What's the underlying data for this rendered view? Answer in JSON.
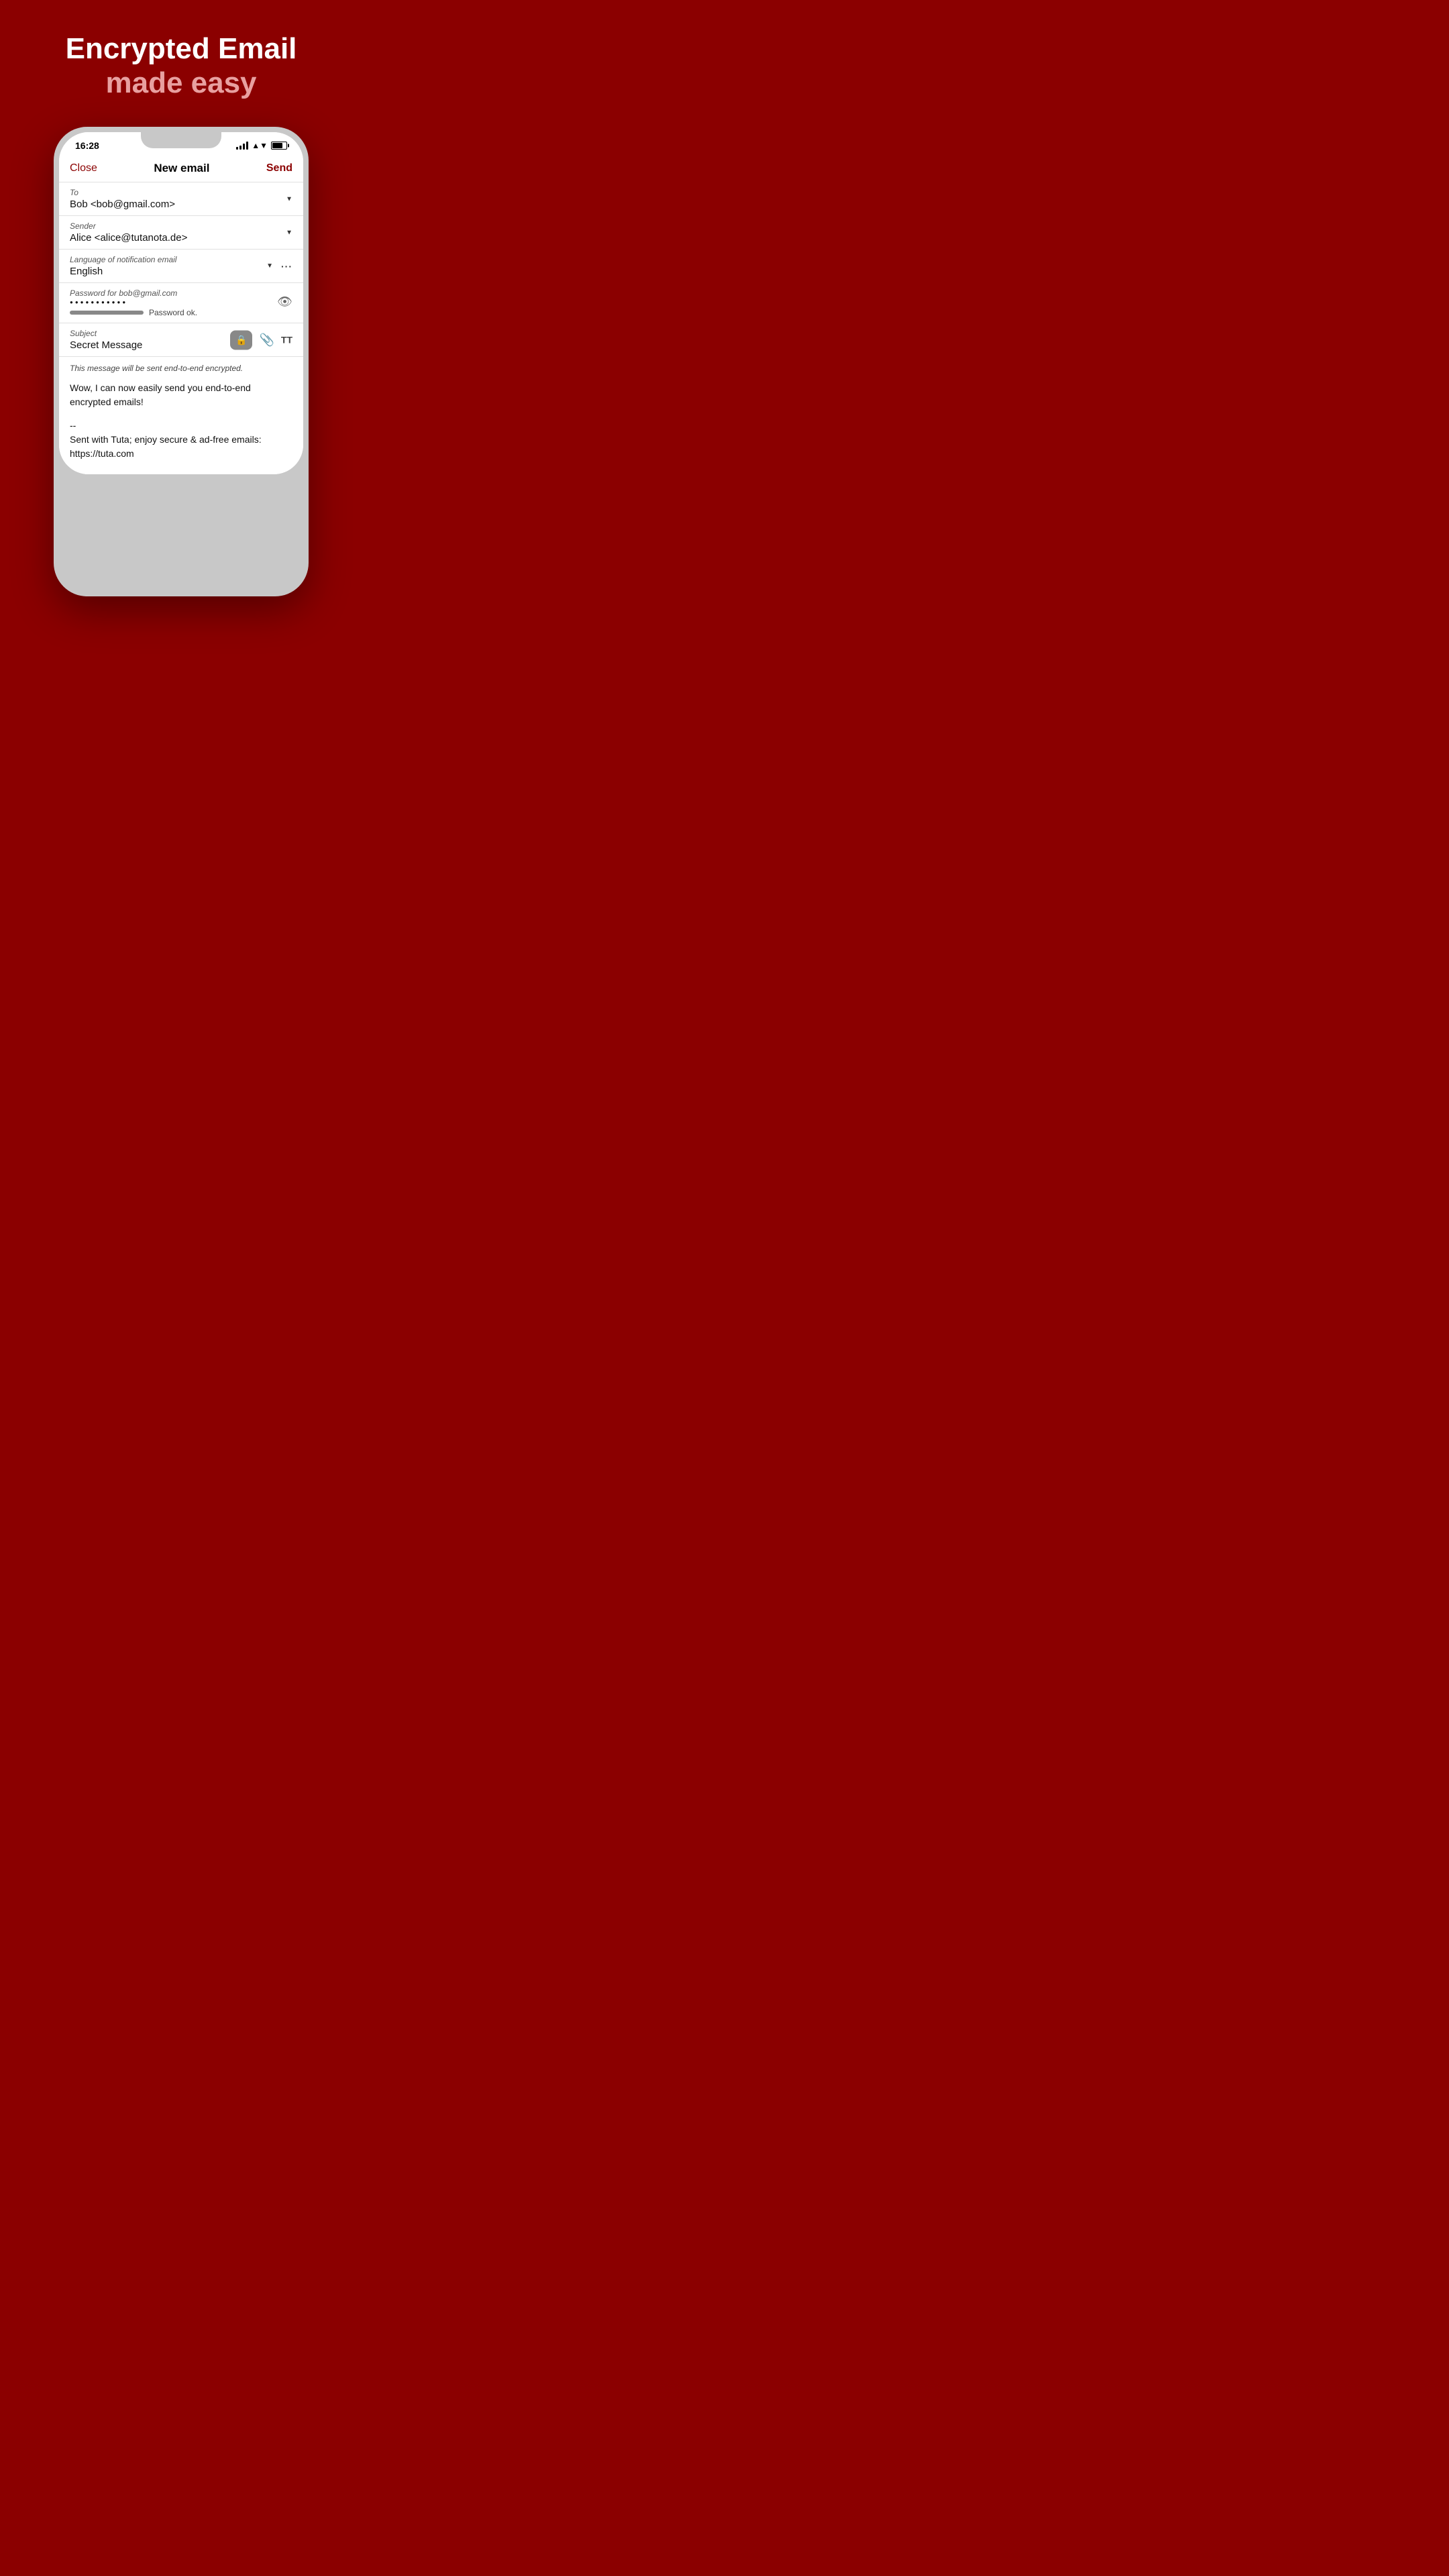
{
  "hero": {
    "title": "Encrypted Email",
    "subtitle": "made easy"
  },
  "phone": {
    "status_bar": {
      "time": "16:28"
    },
    "email_compose": {
      "nav": {
        "close_label": "Close",
        "title": "New email",
        "send_label": "Send"
      },
      "to_field": {
        "label": "To",
        "value": "Bob <bob@gmail.com>"
      },
      "sender_field": {
        "label": "Sender",
        "value": "Alice <alice@tutanota.de>"
      },
      "language_field": {
        "label": "Language of notification email",
        "value": "English"
      },
      "password_field": {
        "label": "Password for bob@gmail.com",
        "dots": "●●●●●●●●●●●",
        "strength_label": "Password ok."
      },
      "subject_field": {
        "label": "Subject",
        "value": "Secret Message"
      },
      "body": {
        "note": "This message will be sent end-to-end encrypted.",
        "message": "Wow, I can now easily send you end-to-end encrypted emails!",
        "signature": "--\nSent with Tuta; enjoy secure & ad-free emails:\nhttps://tuta.com"
      }
    }
  }
}
